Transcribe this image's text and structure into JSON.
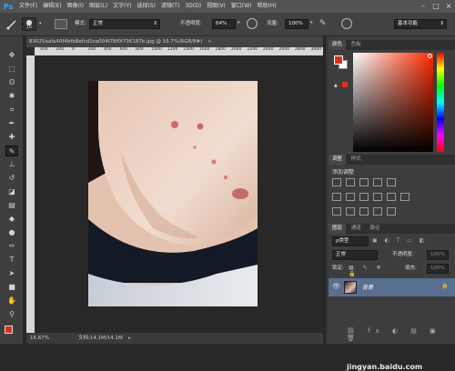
{
  "app": {
    "logo": "Ps"
  },
  "menu": [
    "文件(F)",
    "编辑(E)",
    "图像(I)",
    "图层(L)",
    "文字(Y)",
    "选择(S)",
    "滤镜(T)",
    "3D(D)",
    "视图(V)",
    "窗口(W)",
    "帮助(H)"
  ],
  "window_controls": {
    "minimize": "–",
    "maximize": "□",
    "close": "×"
  },
  "options": {
    "brush_size": "10",
    "mode_label": "模式:",
    "mode_value": "正常",
    "opacity_label": "不透明度:",
    "opacity_value": "64%",
    "flow_label": "流量:",
    "flow_value": "100%",
    "workspace": "基本功能"
  },
  "document": {
    "tab_title": "83025aafa40f4bfb8efcd1ca004f78f0f736187b.jpg @ 16.7%(RGB/8#)",
    "ruler_ticks": [
      "400",
      "200",
      "0",
      "200",
      "400",
      "600",
      "800",
      "1000",
      "1200",
      "1400",
      "1600",
      "1800",
      "2000",
      "2200",
      "2400",
      "2600",
      "2800",
      "3000"
    ],
    "zoom": "16.67%",
    "doc_info": "文档:14.1M/14.1M"
  },
  "color_panel": {
    "tabs": [
      "颜色",
      "色板"
    ],
    "foreground": "#d6321e",
    "background": "#ffffff"
  },
  "adjustments_panel": {
    "tabs": [
      "调整",
      "样式"
    ],
    "title": "添加调整"
  },
  "layers_panel": {
    "tabs": [
      "图层",
      "通道",
      "路径"
    ],
    "kind_label": "ρ类型",
    "blend_mode": "正常",
    "opacity_label": "不透明度:",
    "opacity_value": "100%",
    "lock_label": "锁定:",
    "fill_label": "填充:",
    "fill_value": "100%",
    "layer_name": "背景"
  },
  "watermark": "jingyan.baidu.com"
}
